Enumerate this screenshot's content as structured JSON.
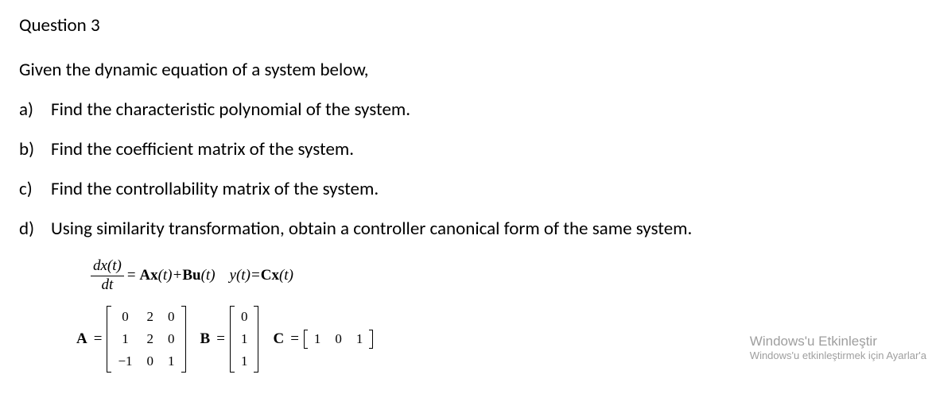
{
  "title": "Question 3",
  "intro": "Given the dynamic equation of a system below,",
  "items": {
    "a": {
      "label": "a)",
      "text": "Find the characteristic polynomial of the system."
    },
    "b": {
      "label": "b)",
      "text": "Find the coefficient matrix of the system."
    },
    "c": {
      "label": "c)",
      "text": "Find the controllability matrix of the system."
    },
    "d": {
      "label": "d)",
      "text": "Using similarity transformation, obtain a controller canonical form of the same system."
    }
  },
  "eq1": {
    "frac_num": "dx(t)",
    "frac_den": "dt",
    "rhs1_a": "= ",
    "rhs1_A": "A",
    "rhs1_x": "x",
    "rhs1_paren1": "(t)+",
    "rhs1_B": "B",
    "rhs1_u": "u",
    "rhs1_paren2": "(t)",
    "gap": "   ",
    "rhs2_y": "y",
    "rhs2_paren1": "(t)=",
    "rhs2_C": "C",
    "rhs2_x": "x",
    "rhs2_paren2": "(t)"
  },
  "matrixA": {
    "label": "A",
    "eq": "=",
    "cells": [
      "0",
      "2",
      "0",
      "1",
      "2",
      "0",
      "−1",
      "0",
      "1"
    ]
  },
  "matrixB": {
    "label": "B",
    "eq": "=",
    "cells": [
      "0",
      "1",
      "1"
    ]
  },
  "matrixC": {
    "label": "C",
    "eq": "=",
    "cells": [
      "1",
      "0",
      "1"
    ]
  },
  "watermark": {
    "line1": "Windows'u Etkinleştir",
    "line2": "Windows'u etkinleştirmek için Ayarlar'a"
  }
}
